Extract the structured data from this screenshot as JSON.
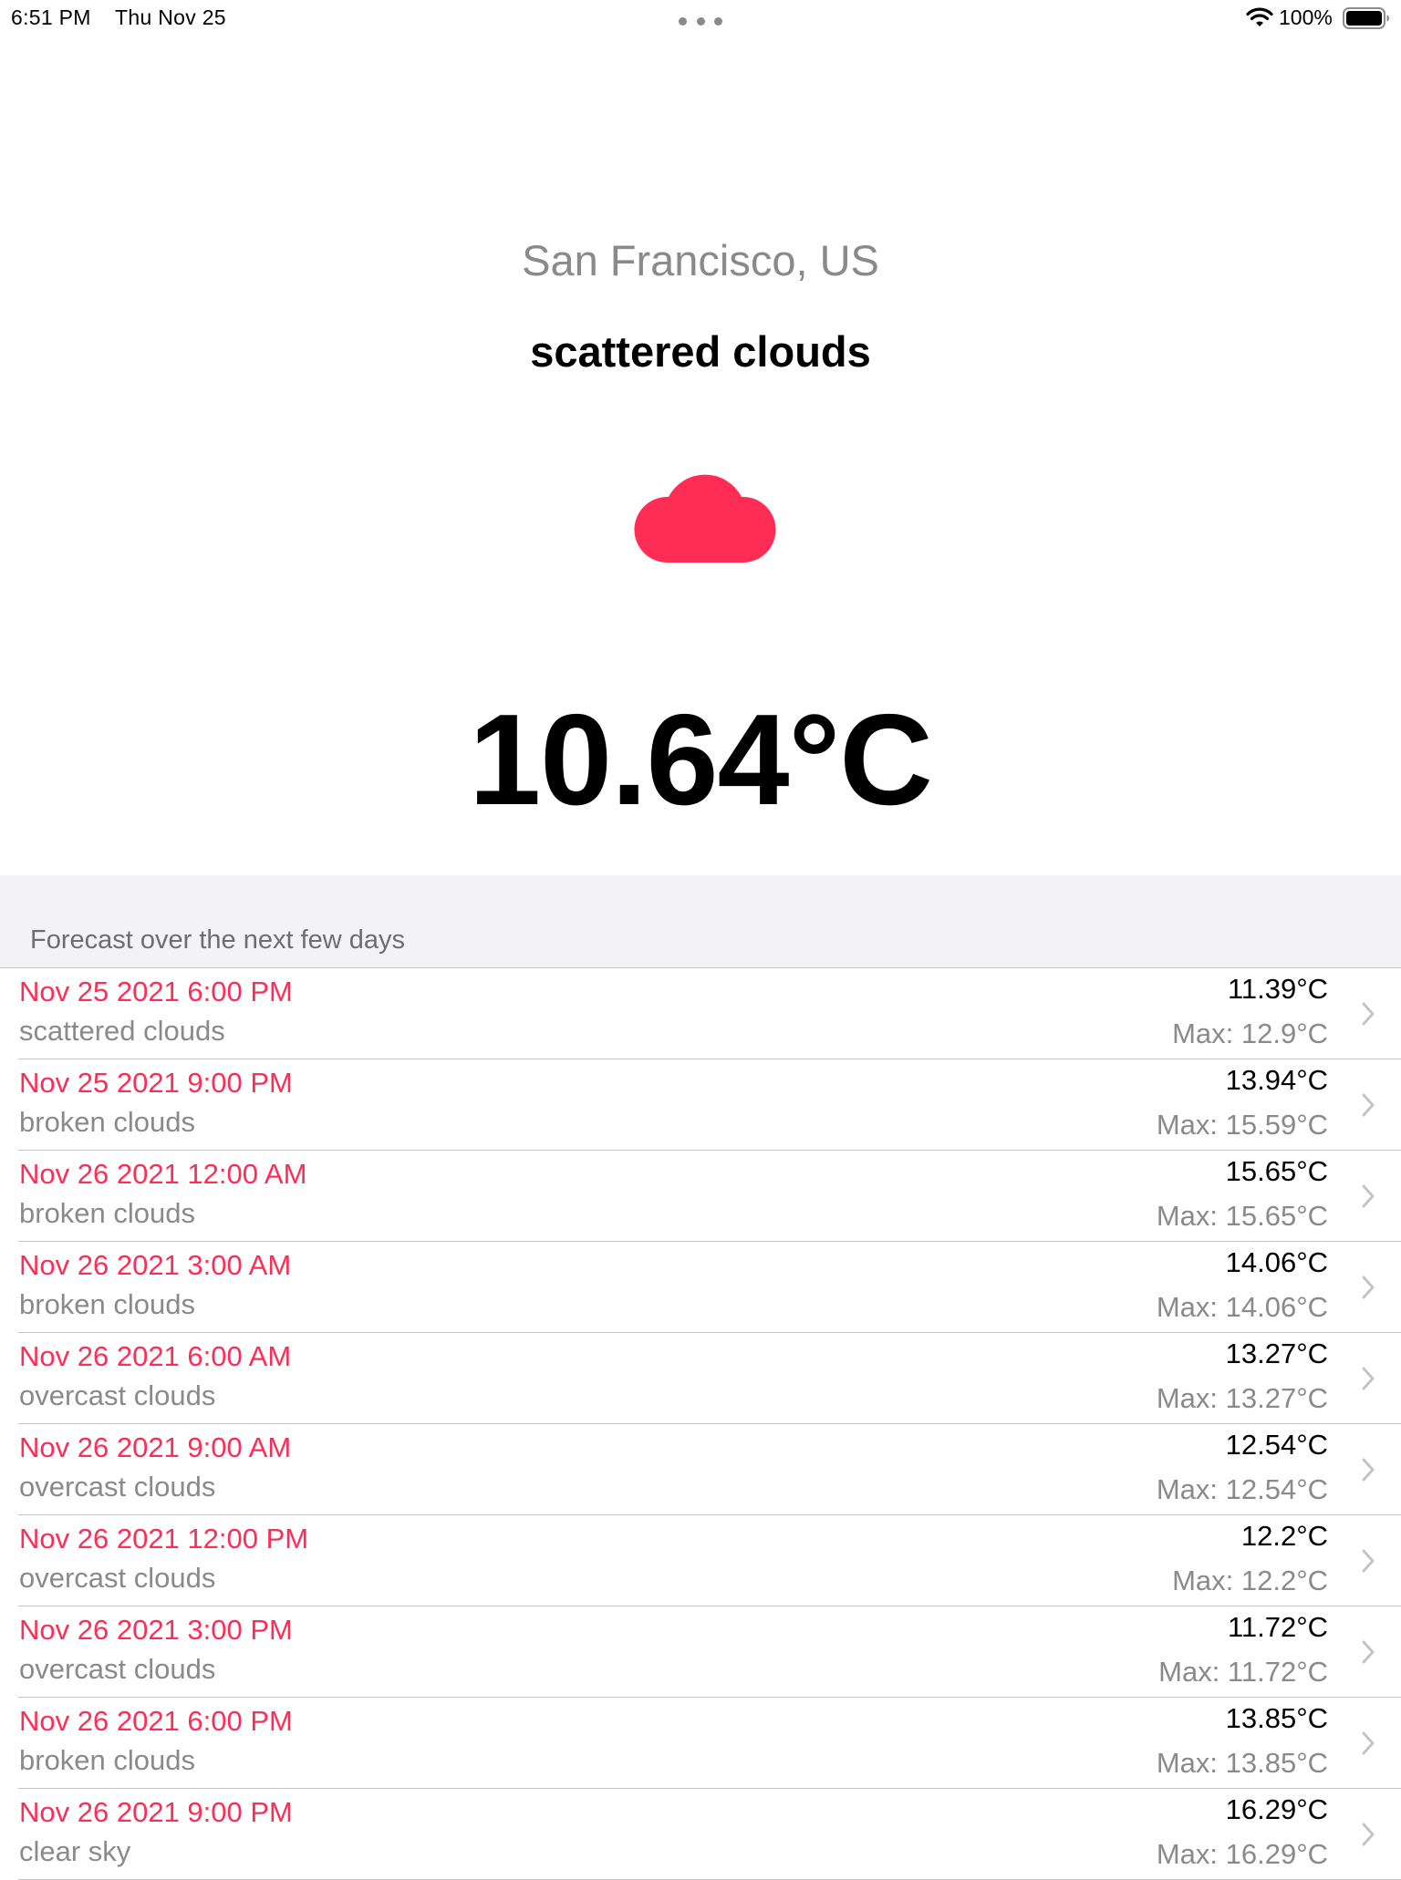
{
  "status_bar": {
    "time": "6:51 PM",
    "date": "Thu Nov 25",
    "battery_percent": "100%",
    "icons": [
      "more-dots-icon",
      "wifi-icon",
      "battery-icon"
    ]
  },
  "current": {
    "location": "San Francisco, US",
    "description": "scattered clouds",
    "icon": "cloud-icon",
    "temperature": "10.64°C"
  },
  "forecast": {
    "header": "Forecast over the next few days",
    "items": [
      {
        "date": "Nov 25 2021 6:00 PM",
        "description": "scattered clouds",
        "temp": "11.39°C",
        "max": "Max: 12.9°C"
      },
      {
        "date": "Nov 25 2021 9:00 PM",
        "description": "broken clouds",
        "temp": "13.94°C",
        "max": "Max: 15.59°C"
      },
      {
        "date": "Nov 26 2021 12:00 AM",
        "description": "broken clouds",
        "temp": "15.65°C",
        "max": "Max: 15.65°C"
      },
      {
        "date": "Nov 26 2021 3:00 AM",
        "description": "broken clouds",
        "temp": "14.06°C",
        "max": "Max: 14.06°C"
      },
      {
        "date": "Nov 26 2021 6:00 AM",
        "description": "overcast clouds",
        "temp": "13.27°C",
        "max": "Max: 13.27°C"
      },
      {
        "date": "Nov 26 2021 9:00 AM",
        "description": "overcast clouds",
        "temp": "12.54°C",
        "max": "Max: 12.54°C"
      },
      {
        "date": "Nov 26 2021 12:00 PM",
        "description": "overcast clouds",
        "temp": "12.2°C",
        "max": "Max: 12.2°C"
      },
      {
        "date": "Nov 26 2021 3:00 PM",
        "description": "overcast clouds",
        "temp": "11.72°C",
        "max": "Max: 11.72°C"
      },
      {
        "date": "Nov 26 2021 6:00 PM",
        "description": "broken clouds",
        "temp": "13.85°C",
        "max": "Max: 13.85°C"
      },
      {
        "date": "Nov 26 2021 9:00 PM",
        "description": "clear sky",
        "temp": "16.29°C",
        "max": "Max: 16.29°C"
      }
    ]
  },
  "colors": {
    "accent": "#ff2d55",
    "secondary_text": "#8a8a8e",
    "grouped_background": "#f2f2f7",
    "separator": "#c6c6c8"
  }
}
